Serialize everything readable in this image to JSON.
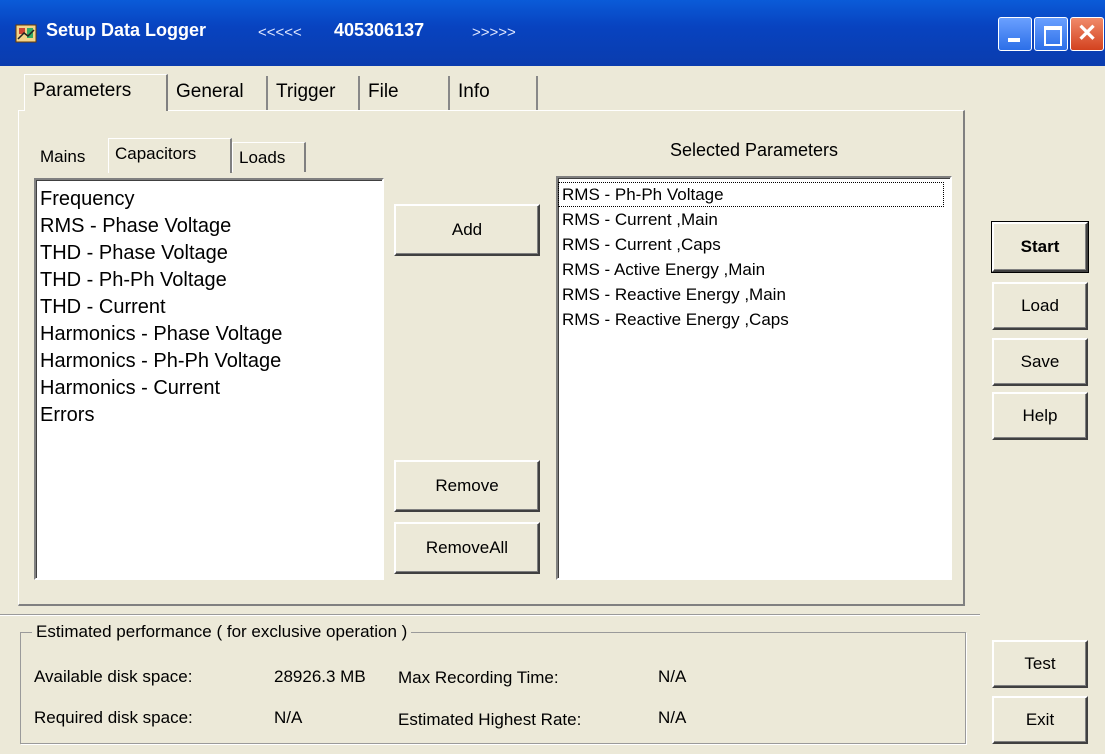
{
  "window": {
    "title": "Setup Data Logger",
    "marker_left": "<<<<<",
    "serial": "405306137",
    "marker_right": ">>>>>"
  },
  "tabs": [
    "Parameters",
    "General",
    "Trigger",
    "File",
    "Info"
  ],
  "subtabs": [
    "Mains",
    "Capacitors",
    "Loads"
  ],
  "available_list": {
    "items": [
      "Frequency",
      "RMS - Phase Voltage",
      "THD - Phase Voltage",
      "THD - Ph-Ph Voltage",
      "THD - Current",
      "Harmonics - Phase Voltage",
      "Harmonics - Ph-Ph Voltage",
      "Harmonics - Current",
      "Errors"
    ]
  },
  "selected_list": {
    "heading": "Selected Parameters",
    "items": [
      "RMS - Ph-Ph Voltage",
      "RMS - Current ,Main",
      "RMS - Current ,Caps",
      "RMS - Active Energy ,Main",
      "RMS - Reactive Energy ,Main",
      "RMS - Reactive Energy ,Caps"
    ]
  },
  "buttons": {
    "add": "Add",
    "remove": "Remove",
    "remove_all": "RemoveAll",
    "start": "Start",
    "load": "Load",
    "save": "Save",
    "help": "Help",
    "test": "Test",
    "exit": "Exit"
  },
  "performance": {
    "legend": "Estimated performance ( for exclusive operation )",
    "available_label": "Available  disk space:",
    "available_value": "28926.3 MB",
    "max_time_label": "Max Recording Time:",
    "max_time_value": "N/A",
    "required_label": "Required disk space:",
    "required_value": "N/A",
    "highest_rate_label": "Estimated Highest Rate:",
    "highest_rate_value": "N/A"
  },
  "icons": {
    "app": "app-icon",
    "minimize": "minimize-icon",
    "maximize": "maximize-icon",
    "close": "close-icon"
  }
}
